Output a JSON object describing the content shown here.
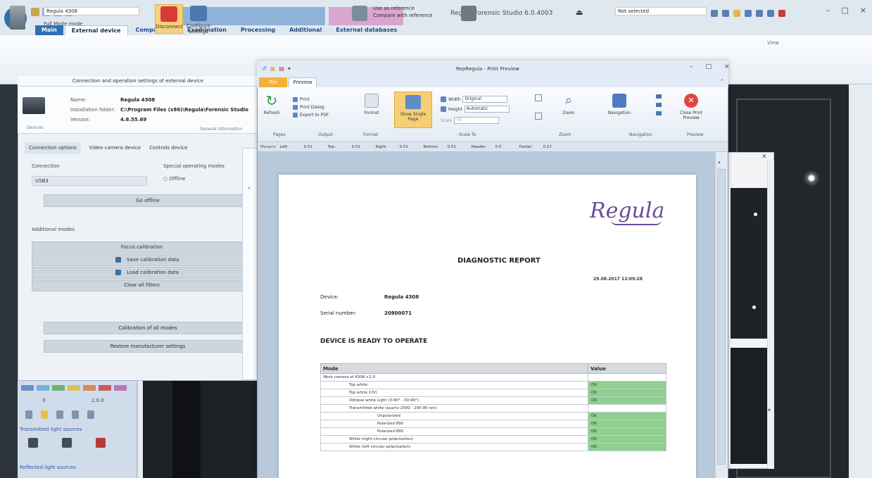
{
  "app": {
    "title": "Regula Forensic Studio 6.0.4003",
    "tabs": [
      {
        "label": "Main",
        "active": false,
        "file": true
      },
      {
        "label": "External device",
        "active": true
      },
      {
        "label": "Comparison",
        "active": false
      },
      {
        "label": "Examination",
        "active": false
      },
      {
        "label": "Processing",
        "active": false
      },
      {
        "label": "Additional",
        "active": false
      },
      {
        "label": "External databases",
        "active": false
      }
    ],
    "controls": {
      "minimize": "–",
      "maximize": "□",
      "close": "×"
    },
    "colors": {
      "ribbon_accent": "#2f6fb3",
      "context_band_blue": "#8fb2d9",
      "context_band_pink": "#d9a6cf"
    }
  },
  "main_ribbon": {
    "device_name": "Regula 4308",
    "full_mode": "Full Mode mode",
    "disconnect": "Disconnect",
    "configure": "Configure settings",
    "use_reference": "Use as reference",
    "compare_reference": "Compare with reference",
    "not_selected": "Not selected",
    "view_group": "View"
  },
  "left_panel": {
    "value_1": "0",
    "value_2": "2.0.0",
    "section_1": "Transmitted light sources",
    "section_2": "Reflected light sources"
  },
  "connection_window": {
    "title": "Connection and operation settings of external device",
    "device_group": "Devices",
    "name_key": "Name:",
    "name_val": "Regula 4308",
    "install_key": "Installation folder:",
    "install_val": "C:\\Program Files (x86)\\Regula\\Forensic Studio",
    "version_key": "Version:",
    "version_val": "4.6.55.69",
    "info_group": "General information",
    "tabs": [
      "Connection options",
      "Video camera device",
      "Controls device"
    ],
    "connection_label": "Connection",
    "connection_value": "USB3",
    "special_label": "Special operating modes",
    "offline_radio": "Offline",
    "offline_button": "Go offline",
    "additional_label": "Additional modes",
    "btn_focus": "Focus calibration",
    "btn_save": "Save calibration data",
    "btn_load": "Load calibration data",
    "btn_clear": "Clear all filters",
    "btn_calibrate": "Calibration of all modes",
    "btn_restore": "Restore manufacturer settings"
  },
  "print_preview": {
    "title": "RepRegula - Print Preview",
    "file_tab": "File",
    "preview_tab": "Preview",
    "refresh": "Refresh",
    "print": "Print",
    "print_dialog": "Print Dialog",
    "export_pdf": "Export to PDF",
    "format": "Format",
    "show_single": "Show Single Page",
    "width_label": "Width",
    "width_value": "Original",
    "height_label": "Height",
    "height_value": "Automatic",
    "scale_label": "Scale",
    "scale_value": "75",
    "zoom": "Zoom",
    "navigation": "Navigation",
    "close_preview": "Close Print Preview",
    "groups": {
      "pages": "Pages",
      "output": "Output",
      "format": "Format",
      "scale": "Scale To",
      "zoom": "Zoom",
      "navigation": "Navigation",
      "preview": "Preview"
    },
    "ruler": [
      {
        "k": "Margins",
        "v": "Left:"
      },
      {
        "k": "",
        "v": "0.51"
      },
      {
        "k": "",
        "v": "Top:"
      },
      {
        "k": "",
        "v": "0.51"
      },
      {
        "k": "",
        "v": "Right:"
      },
      {
        "k": "",
        "v": "0.51"
      },
      {
        "k": "",
        "v": "Bottom:"
      },
      {
        "k": "",
        "v": "0.51"
      },
      {
        "k": "",
        "v": "Header:"
      },
      {
        "k": "",
        "v": "0.5"
      },
      {
        "k": "",
        "v": "Footer:"
      },
      {
        "k": "",
        "v": "0.17"
      }
    ]
  },
  "report": {
    "logo": "Regula",
    "title": "DIAGNOSTIC REPORT",
    "datetime": "29.08.2017 12:09:28",
    "device_key": "Device:",
    "device_val": "Regula 4308",
    "serial_key": "Serial number:",
    "serial_val": "20800071",
    "status": "DEVICE IS READY TO OPERATE",
    "table": {
      "headers": [
        "Mode",
        "Value"
      ],
      "rows": [
        {
          "indent": 0,
          "mode": "Work camera of 4308 v.2.0",
          "value": "",
          "ok": false
        },
        {
          "indent": 1,
          "mode": "Top white",
          "value": "OK",
          "ok": true
        },
        {
          "indent": 1,
          "mode": "Top white (UV)",
          "value": "OK",
          "ok": true
        },
        {
          "indent": 1,
          "mode": "Oblique white Light (3-90° - 30-90°)",
          "value": "OK",
          "ok": true
        },
        {
          "indent": 1,
          "mode": "Transmitted white (quartz 2500 - 290-90 nm)",
          "value": "",
          "ok": false
        },
        {
          "indent": 2,
          "mode": "Unpolarized",
          "value": "OK",
          "ok": true
        },
        {
          "indent": 2,
          "mode": "Polarized 890",
          "value": "OK",
          "ok": true
        },
        {
          "indent": 2,
          "mode": "Polarized 890",
          "value": "OK",
          "ok": true
        },
        {
          "indent": 1,
          "mode": "White (right circular polarization)",
          "value": "OK",
          "ok": true
        },
        {
          "indent": 1,
          "mode": "White (left circular polarization)",
          "value": "OK",
          "ok": true
        }
      ]
    }
  }
}
